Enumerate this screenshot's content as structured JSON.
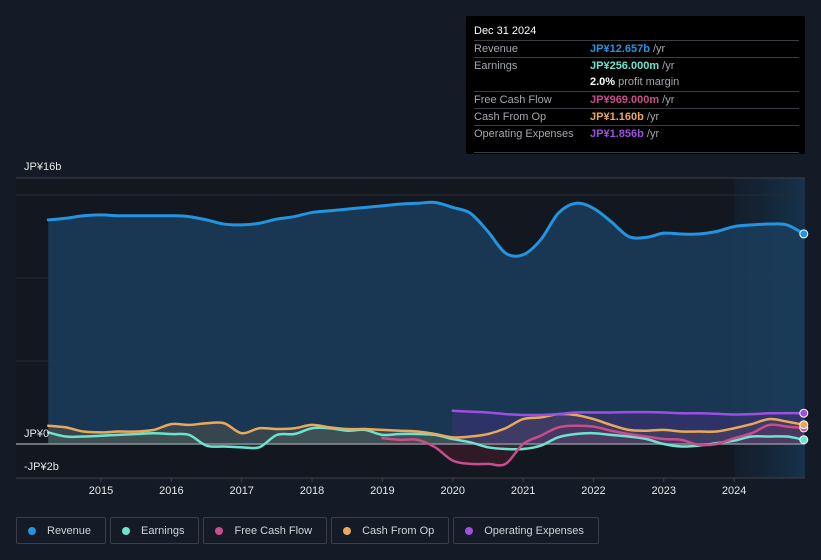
{
  "tooltip": {
    "date": "Dec 31 2024",
    "rows": [
      {
        "label": "Revenue",
        "value": "JP¥12.657b",
        "unit": " /yr",
        "color": "#2394df"
      },
      {
        "label": "Earnings",
        "value": "JP¥256.000m",
        "unit": " /yr",
        "color": "#6de3cf"
      },
      {
        "label": "",
        "value": "2.0%",
        "unit": " profit margin",
        "color": "#ffffff"
      },
      {
        "label": "Free Cash Flow",
        "value": "JP¥969.000m",
        "unit": " /yr",
        "color": "#c94d8c"
      },
      {
        "label": "Cash From Op",
        "value": "JP¥1.160b",
        "unit": " /yr",
        "color": "#e8a95b"
      },
      {
        "label": "Operating Expenses",
        "value": "JP¥1.856b",
        "unit": " /yr",
        "color": "#9d4fe0"
      }
    ]
  },
  "legend": [
    {
      "label": "Revenue",
      "color": "#2394df"
    },
    {
      "label": "Earnings",
      "color": "#6de3cf"
    },
    {
      "label": "Free Cash Flow",
      "color": "#c94d8c"
    },
    {
      "label": "Cash From Op",
      "color": "#e8a95b"
    },
    {
      "label": "Operating Expenses",
      "color": "#9d4fe0"
    }
  ],
  "chart_data": {
    "type": "area",
    "title": "",
    "xlabel": "",
    "ylabel": "",
    "y_tick_labels": [
      {
        "value": 16,
        "label": "JP¥16b"
      },
      {
        "value": 0,
        "label": "JP¥0"
      },
      {
        "value": -2,
        "label": "-JP¥2b"
      }
    ],
    "x_tick_labels": [
      "2015",
      "2016",
      "2017",
      "2018",
      "2019",
      "2020",
      "2021",
      "2022",
      "2023",
      "2024"
    ],
    "x_ticks": [
      2015,
      2016,
      2017,
      2018,
      2019,
      2020,
      2021,
      2022,
      2023,
      2024
    ],
    "xlim": [
      2013.75,
      2024.99
    ],
    "ylim": [
      -2,
      16
    ],
    "gridlines": [
      5,
      10,
      15
    ],
    "forecast_start": 2024.0,
    "units": "JP¥ billions",
    "series": [
      {
        "name": "Revenue",
        "color": "#2394df",
        "x": [
          2014.25,
          2014.5,
          2014.75,
          2015.0,
          2015.25,
          2015.5,
          2015.75,
          2016.0,
          2016.25,
          2016.5,
          2016.75,
          2017.0,
          2017.25,
          2017.5,
          2017.75,
          2018.0,
          2018.25,
          2018.5,
          2018.75,
          2019.0,
          2019.25,
          2019.5,
          2019.75,
          2020.0,
          2020.25,
          2020.5,
          2020.75,
          2021.0,
          2021.25,
          2021.5,
          2021.75,
          2022.0,
          2022.25,
          2022.5,
          2022.75,
          2023.0,
          2023.25,
          2023.5,
          2023.75,
          2024.0,
          2024.25,
          2024.5,
          2024.75,
          2024.99
        ],
        "values": [
          13.5,
          13.6,
          13.75,
          13.8,
          13.75,
          13.75,
          13.75,
          13.75,
          13.7,
          13.5,
          13.25,
          13.2,
          13.3,
          13.55,
          13.7,
          13.95,
          14.05,
          14.15,
          14.25,
          14.35,
          14.45,
          14.5,
          14.55,
          14.25,
          13.9,
          12.8,
          11.5,
          11.4,
          12.3,
          13.9,
          14.5,
          14.2,
          13.4,
          12.5,
          12.45,
          12.7,
          12.65,
          12.65,
          12.8,
          13.1,
          13.2,
          13.25,
          13.2,
          12.657
        ]
      },
      {
        "name": "Earnings",
        "color": "#6de3cf",
        "x": [
          2014.25,
          2014.5,
          2014.75,
          2015.0,
          2015.25,
          2015.5,
          2015.75,
          2016.0,
          2016.25,
          2016.5,
          2016.75,
          2017.0,
          2017.25,
          2017.5,
          2017.75,
          2018.0,
          2018.25,
          2018.5,
          2018.75,
          2019.0,
          2019.25,
          2019.5,
          2019.75,
          2020.0,
          2020.25,
          2020.5,
          2020.75,
          2021.0,
          2021.25,
          2021.5,
          2021.75,
          2022.0,
          2022.25,
          2022.5,
          2022.75,
          2023.0,
          2023.25,
          2023.5,
          2023.75,
          2024.0,
          2024.25,
          2024.5,
          2024.75,
          2024.99
        ],
        "values": [
          0.7,
          0.45,
          0.45,
          0.5,
          0.55,
          0.6,
          0.65,
          0.6,
          0.55,
          -0.1,
          -0.15,
          -0.2,
          -0.2,
          0.55,
          0.6,
          0.95,
          0.95,
          0.8,
          0.85,
          0.55,
          0.6,
          0.6,
          0.55,
          0.3,
          0.1,
          -0.2,
          -0.3,
          -0.3,
          -0.1,
          0.4,
          0.6,
          0.65,
          0.55,
          0.45,
          0.3,
          0.0,
          -0.15,
          -0.1,
          0.05,
          0.2,
          0.45,
          0.45,
          0.45,
          0.256
        ]
      },
      {
        "name": "Free Cash Flow",
        "color": "#c94d8c",
        "x": [
          2019.0,
          2019.25,
          2019.5,
          2019.75,
          2020.0,
          2020.25,
          2020.5,
          2020.75,
          2021.0,
          2021.25,
          2021.5,
          2021.75,
          2022.0,
          2022.25,
          2022.5,
          2022.75,
          2023.0,
          2023.25,
          2023.5,
          2023.75,
          2024.0,
          2024.25,
          2024.5,
          2024.75,
          2024.99
        ],
        "values": [
          0.35,
          0.25,
          0.25,
          -0.2,
          -1.0,
          -1.2,
          -1.2,
          -1.2,
          0.0,
          0.5,
          1.0,
          1.1,
          1.05,
          0.8,
          0.6,
          0.45,
          0.3,
          0.25,
          -0.05,
          0.0,
          0.35,
          0.65,
          1.15,
          1.05,
          0.969
        ]
      },
      {
        "name": "Cash From Op",
        "color": "#e8a95b",
        "x": [
          2014.25,
          2014.5,
          2014.75,
          2015.0,
          2015.25,
          2015.5,
          2015.75,
          2016.0,
          2016.25,
          2016.5,
          2016.75,
          2017.0,
          2017.25,
          2017.5,
          2017.75,
          2018.0,
          2018.25,
          2018.5,
          2018.75,
          2019.0,
          2019.25,
          2019.5,
          2019.75,
          2020.0,
          2020.25,
          2020.5,
          2020.75,
          2021.0,
          2021.25,
          2021.5,
          2021.75,
          2022.0,
          2022.25,
          2022.5,
          2022.75,
          2023.0,
          2023.25,
          2023.5,
          2023.75,
          2024.0,
          2024.25,
          2024.5,
          2024.75,
          2024.99
        ],
        "values": [
          1.1,
          1.0,
          0.75,
          0.7,
          0.75,
          0.75,
          0.85,
          1.2,
          1.15,
          1.25,
          1.25,
          0.65,
          0.95,
          0.9,
          0.95,
          1.15,
          1.0,
          0.9,
          0.9,
          0.85,
          0.8,
          0.75,
          0.6,
          0.4,
          0.45,
          0.6,
          0.95,
          1.5,
          1.6,
          1.8,
          1.75,
          1.5,
          1.15,
          0.85,
          0.8,
          0.85,
          0.75,
          0.75,
          0.75,
          0.95,
          1.2,
          1.5,
          1.35,
          1.16
        ]
      },
      {
        "name": "Operating Expenses",
        "color": "#9d4fe0",
        "x": [
          2020.0,
          2020.25,
          2020.5,
          2020.75,
          2021.0,
          2021.25,
          2021.5,
          2021.75,
          2022.0,
          2022.25,
          2022.5,
          2022.75,
          2023.0,
          2023.25,
          2023.5,
          2023.75,
          2024.0,
          2024.25,
          2024.5,
          2024.75,
          2024.99
        ],
        "values": [
          2.0,
          1.95,
          1.9,
          1.8,
          1.75,
          1.75,
          1.8,
          1.9,
          1.9,
          1.9,
          1.92,
          1.92,
          1.9,
          1.85,
          1.85,
          1.82,
          1.78,
          1.8,
          1.85,
          1.86,
          1.856
        ]
      }
    ]
  }
}
